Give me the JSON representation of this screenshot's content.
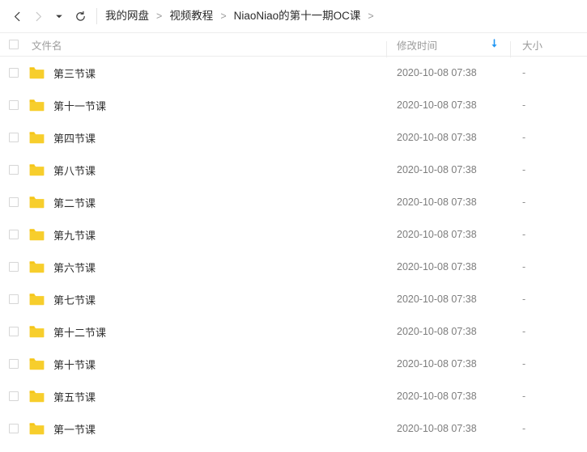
{
  "toolbar": {
    "back_icon": "chevron-left-icon",
    "forward_icon": "chevron-right-icon",
    "dropdown_icon": "caret-down-icon",
    "refresh_icon": "refresh-icon",
    "breadcrumb": [
      "我的网盘",
      "视频教程",
      "NiaoNiao的第十一期OC课"
    ],
    "breadcrumb_separator": ">",
    "trailing_separator": ">"
  },
  "list_header": {
    "select_all_checkbox": "checkbox-icon",
    "col_name": "文件名",
    "col_date": "修改时间",
    "col_size": "大小",
    "sort_icon": "arrow-down-icon",
    "sort_color": "#2196f3",
    "sort_direction": "desc"
  },
  "colors": {
    "folder": "#f7ce2c",
    "folder_tab": "#f5c518",
    "accent": "#2196f3",
    "border": "#ececec",
    "text": "#333333",
    "muted": "#8e8e8e"
  },
  "rows": [
    {
      "icon": "folder-icon",
      "name": "第三节课",
      "date": "2020-10-08 07:38",
      "size": "-"
    },
    {
      "icon": "folder-icon",
      "name": "第十一节课",
      "date": "2020-10-08 07:38",
      "size": "-"
    },
    {
      "icon": "folder-icon",
      "name": "第四节课",
      "date": "2020-10-08 07:38",
      "size": "-"
    },
    {
      "icon": "folder-icon",
      "name": "第八节课",
      "date": "2020-10-08 07:38",
      "size": "-"
    },
    {
      "icon": "folder-icon",
      "name": "第二节课",
      "date": "2020-10-08 07:38",
      "size": "-"
    },
    {
      "icon": "folder-icon",
      "name": "第九节课",
      "date": "2020-10-08 07:38",
      "size": "-"
    },
    {
      "icon": "folder-icon",
      "name": "第六节课",
      "date": "2020-10-08 07:38",
      "size": "-"
    },
    {
      "icon": "folder-icon",
      "name": "第七节课",
      "date": "2020-10-08 07:38",
      "size": "-"
    },
    {
      "icon": "folder-icon",
      "name": "第十二节课",
      "date": "2020-10-08 07:38",
      "size": "-"
    },
    {
      "icon": "folder-icon",
      "name": "第十节课",
      "date": "2020-10-08 07:38",
      "size": "-"
    },
    {
      "icon": "folder-icon",
      "name": "第五节课",
      "date": "2020-10-08 07:38",
      "size": "-"
    },
    {
      "icon": "folder-icon",
      "name": "第一节课",
      "date": "2020-10-08 07:38",
      "size": "-"
    }
  ]
}
